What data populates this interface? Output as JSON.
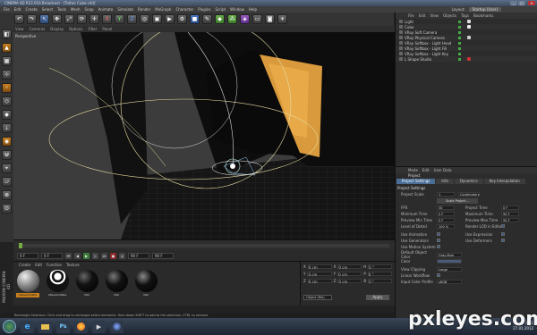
{
  "window": {
    "title": "CINEMA 4D R13.016 Broadcast - [Tattoo Cube.c4d]",
    "controls": [
      "_",
      "□",
      "×"
    ]
  },
  "menubar": {
    "items": [
      "File",
      "Edit",
      "Create",
      "Select",
      "Tools",
      "Mesh",
      "Snap",
      "Animate",
      "Simulate",
      "Render",
      "MoGraph",
      "Character",
      "Plugins",
      "Script",
      "Window",
      "Help"
    ],
    "layout_label": "Layout:",
    "layout_value": "Startup (User)"
  },
  "toolbar": {
    "icons": [
      "undo-icon",
      "redo-icon",
      "live-select-icon",
      "move-icon",
      "scale-icon",
      "rotate-icon",
      "move-icon",
      "x-axis-icon",
      "y-axis-icon",
      "z-axis-icon",
      "world-icon",
      "render-view-icon",
      "render-icon",
      "render-settings-icon",
      "cube-icon",
      "pen-icon",
      "subdivision-icon",
      "array-icon",
      "deformer-icon",
      "floor-icon",
      "camera-icon",
      "light-icon"
    ]
  },
  "lefttoolbar": {
    "icons": [
      "make-editable-icon",
      "model-mode-icon",
      "texture-mode-icon",
      "axis-mode-icon",
      "points-icon",
      "edges-icon",
      "polygons-icon",
      "enable-axis-icon",
      "soft-select-icon",
      "magnet-icon",
      "snap-icon",
      "workplane-icon",
      "lock-icon",
      "locked-workplane-icon"
    ]
  },
  "viewport": {
    "menu": [
      "View",
      "Cameras",
      "Display",
      "Options",
      "Filter",
      "Panel"
    ],
    "label": "Perspective"
  },
  "timeline": {
    "ticks": [
      "0",
      "5",
      "10",
      "15",
      "20",
      "25",
      "30",
      "35",
      "40",
      "45",
      "50",
      "55",
      "60",
      "65",
      "70",
      "75",
      "80",
      "85",
      "90"
    ],
    "end_label": "0 F"
  },
  "transport": {
    "start": "0 F",
    "current": "0 F",
    "end": "90 F",
    "end2": "90 F"
  },
  "materials": {
    "menu": [
      "Create",
      "Edit",
      "Function",
      "Texture"
    ],
    "items": [
      {
        "name": "VRayAdvMate",
        "selected": true
      },
      {
        "name": "VRayAdvMate",
        "selected": false
      },
      {
        "name": "Mat",
        "selected": false
      },
      {
        "name": "Mat",
        "selected": false
      },
      {
        "name": "Mat",
        "selected": false
      }
    ]
  },
  "coordinates": {
    "rows": [
      [
        "X",
        "0 cm",
        "X",
        "0 cm",
        "H",
        "0 °"
      ],
      [
        "Y",
        "0 cm",
        "Y",
        "0 cm",
        "P",
        "0 °"
      ],
      [
        "Z",
        "0 cm",
        "Z",
        "0 cm",
        "B",
        "0 °"
      ]
    ],
    "mode": "Object (Rel)",
    "apply": "Apply"
  },
  "statusbar": {
    "text": "Rectangle Selection: Click and drag to rectangle-select elements. Hold down SHIFT to add to the selection, CTRL to remove."
  },
  "logo": {
    "text": "MAXON CINEMA 4D"
  },
  "object_manager": {
    "menu": [
      "File",
      "Edit",
      "View",
      "Objects",
      "Tags",
      "Bookmarks"
    ],
    "objects": [
      {
        "name": "Light"
      },
      {
        "name": "Cube"
      },
      {
        "name": "VRay Soft Camera"
      },
      {
        "name": "VRay Physical Camera"
      },
      {
        "name": "VRay Softbox - Light Head"
      },
      {
        "name": "VRay Softbox - Light Fill"
      },
      {
        "name": "VRay Softbox - Light Key"
      },
      {
        "name": "L Shape Studio"
      }
    ]
  },
  "attribute_manager": {
    "menu": [
      "Mode",
      "Edit",
      "User Data"
    ],
    "object_name": "Project",
    "tabs": [
      "Project Settings",
      "Info",
      "Dynamics",
      "Key Interpolation"
    ],
    "section": "Project Settings",
    "project_scale": {
      "label": "Project Scale",
      "value": "1",
      "unit": "Centimeters"
    },
    "scale_button": "Scale Project...",
    "rows": [
      {
        "l1": "FPS",
        "v1": "30",
        "l2": "Project Time",
        "v2": "0 F"
      },
      {
        "l1": "Minimum Time",
        "v1": "0 F",
        "l2": "Maximum Time",
        "v2": "90 F"
      },
      {
        "l1": "Preview Min Time",
        "v1": "0 F",
        "l2": "Preview Max Time",
        "v2": "90 F"
      },
      {
        "l1": "Level of Detail",
        "v1": "100 %",
        "l2": "Render LOD in Editor",
        "v2": ""
      }
    ],
    "checks": [
      {
        "l1": "Use Animation",
        "l2": "Use Expression"
      },
      {
        "l1": "Use Generators",
        "l2": "Use Deformers"
      },
      {
        "l1": "Use Motion System",
        "l2": ""
      }
    ],
    "extra": [
      {
        "label": "Default Object Color",
        "value": "Gray-Blue"
      },
      {
        "label": "Color",
        "value": ""
      },
      {
        "label": "View Clipping",
        "value": "Large"
      },
      {
        "label": "Linear Workflow",
        "value": ""
      },
      {
        "label": "Input Color Profile",
        "value": "sRGB"
      }
    ]
  },
  "taskbar": {
    "apps": [
      "ie-icon",
      "folder-icon",
      "photoshop-icon",
      "firefox-icon",
      "media-icon",
      "cinema4d-icon"
    ],
    "time": "2:51",
    "date": "27.01.2012"
  },
  "watermark": {
    "text": "pxleyes.com"
  }
}
